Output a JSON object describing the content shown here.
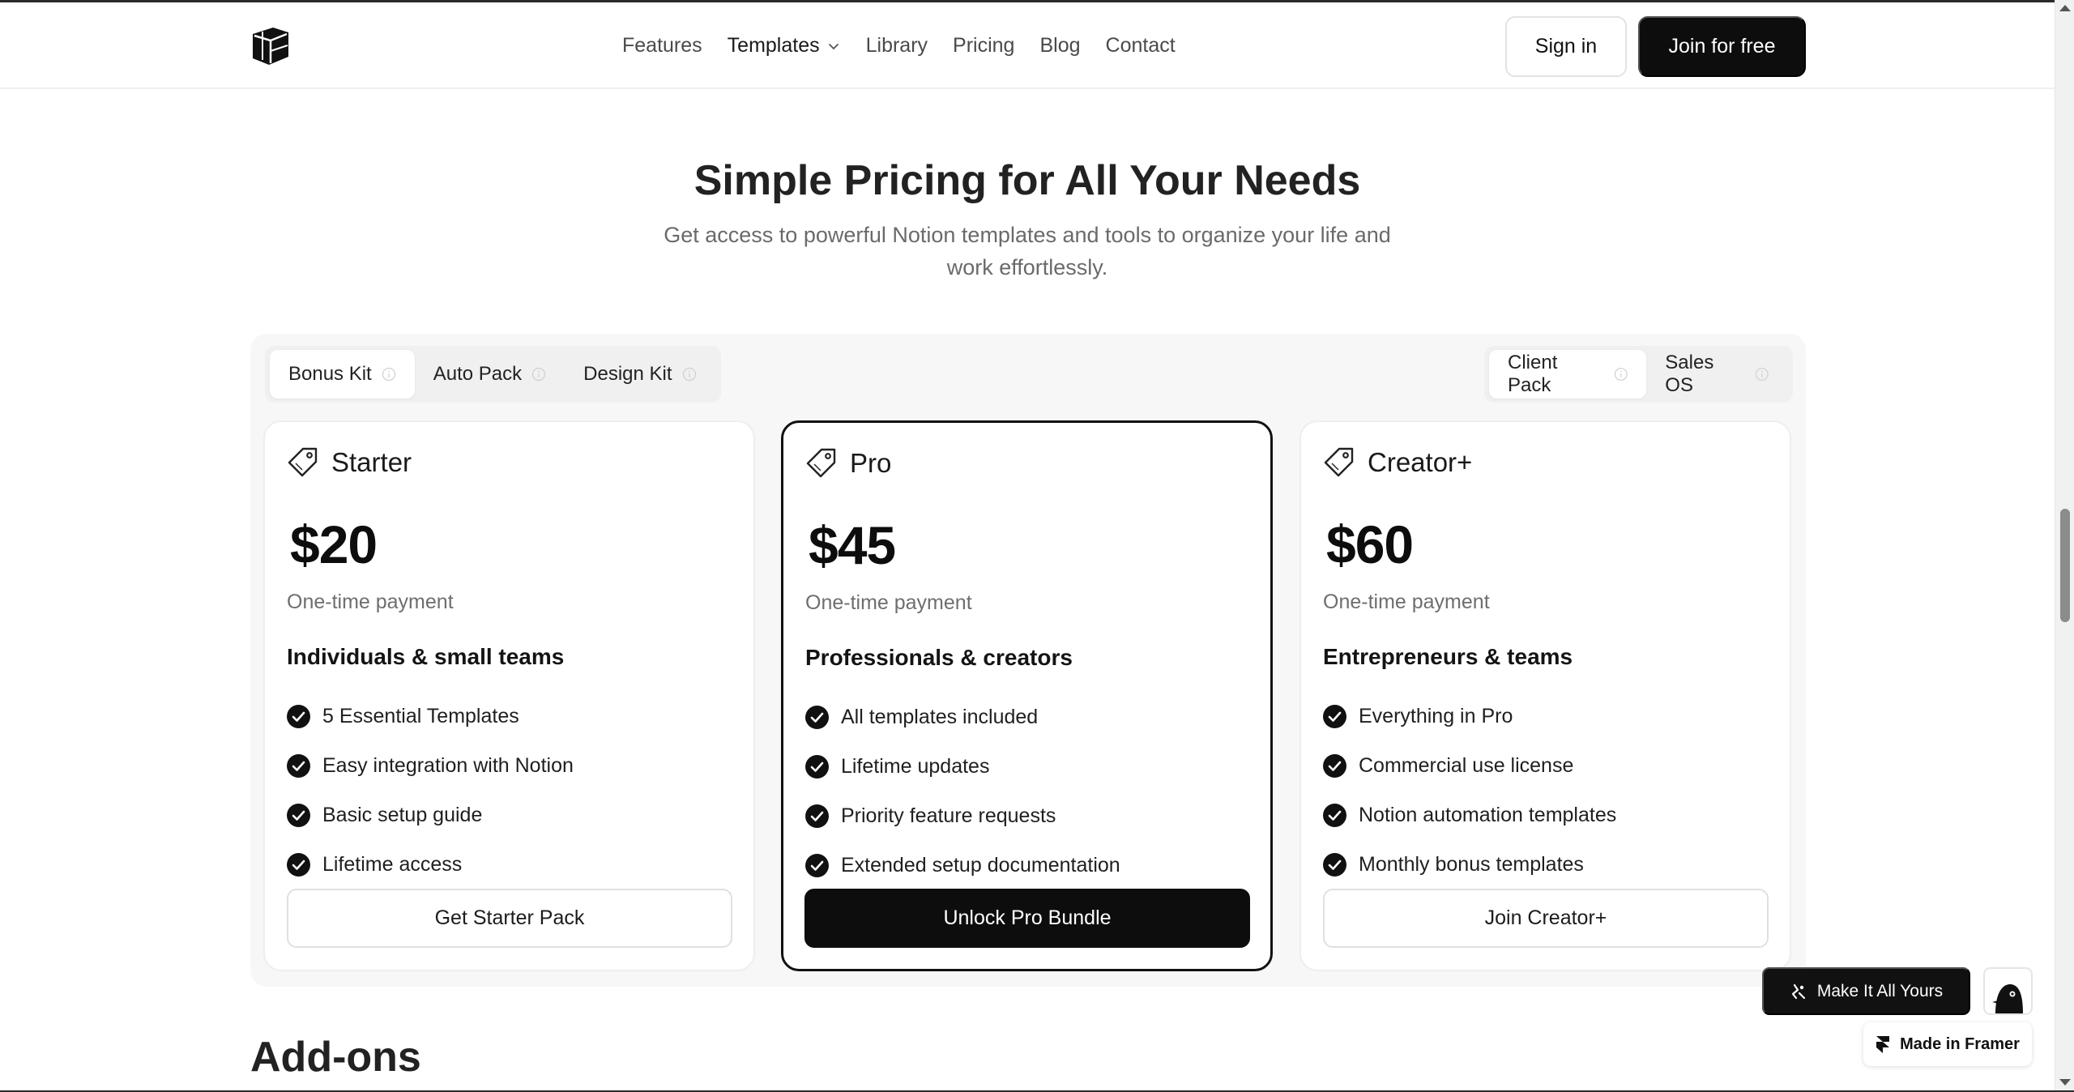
{
  "header": {
    "logo_name": "cube-logo",
    "nav": [
      {
        "label": "Features"
      },
      {
        "label": "Templates"
      },
      {
        "label": "Library"
      },
      {
        "label": "Pricing"
      },
      {
        "label": "Blog"
      },
      {
        "label": "Contact"
      }
    ],
    "sign_in": "Sign in",
    "join": "Join for free"
  },
  "hero": {
    "title": "Simple Pricing for All Your Needs",
    "subtitle": "Get access to powerful Notion templates and tools to organize your life and work effortlessly."
  },
  "tabs_left": [
    {
      "label": "Bonus Kit",
      "active": true
    },
    {
      "label": "Auto Pack",
      "active": false
    },
    {
      "label": "Design Kit",
      "active": false
    }
  ],
  "tabs_right": [
    {
      "label": "Client Pack",
      "active": true
    },
    {
      "label": "Sales OS",
      "active": false
    }
  ],
  "plans": [
    {
      "name": "Starter",
      "price": "$20",
      "payment": "One-time payment",
      "audience": "Individuals & small teams",
      "features": [
        "5 Essential Templates",
        "Easy integration with Notion",
        "Basic setup guide",
        "Lifetime access"
      ],
      "cta": "Get Starter Pack",
      "highlighted": false
    },
    {
      "name": "Pro",
      "price": "$45",
      "payment": "One-time payment",
      "audience": "Professionals & creators",
      "features": [
        "All templates included",
        "Lifetime updates",
        "Priority feature requests",
        "Extended setup documentation"
      ],
      "cta": "Unlock Pro Bundle",
      "highlighted": true
    },
    {
      "name": "Creator+",
      "price": "$60",
      "payment": "One-time payment",
      "audience": "Entrepreneurs & teams",
      "features": [
        "Everything in Pro",
        "Commercial use license",
        "Notion automation templates",
        "Monthly bonus templates"
      ],
      "cta": "Join Creator+",
      "highlighted": false
    }
  ],
  "addons_title": "Add-ons",
  "widgets": {
    "make_it": "Make It All Yours",
    "framer": "Made in Framer"
  },
  "colors": {
    "accent": "#0d0d0d",
    "text_muted": "#6a6a6a",
    "panel_bg": "#f7f7f7"
  }
}
